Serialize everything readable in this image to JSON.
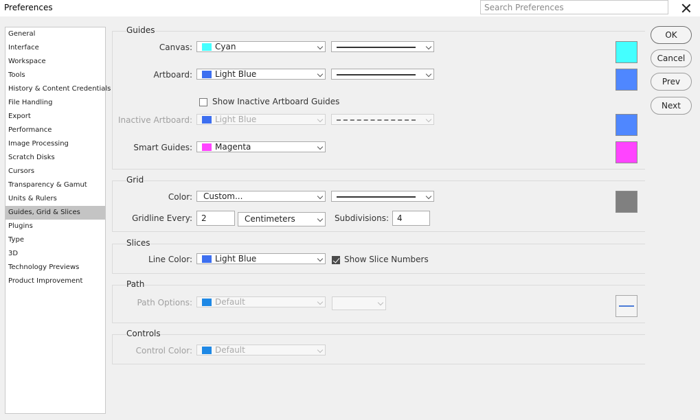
{
  "window": {
    "title": "Preferences"
  },
  "search": {
    "placeholder": "Search Preferences"
  },
  "sidebar": {
    "items": [
      {
        "label": "General"
      },
      {
        "label": "Interface"
      },
      {
        "label": "Workspace"
      },
      {
        "label": "Tools"
      },
      {
        "label": "History & Content Credentials"
      },
      {
        "label": "File Handling"
      },
      {
        "label": "Export"
      },
      {
        "label": "Performance"
      },
      {
        "label": "Image Processing"
      },
      {
        "label": "Scratch Disks"
      },
      {
        "label": "Cursors"
      },
      {
        "label": "Transparency & Gamut"
      },
      {
        "label": "Units & Rulers"
      },
      {
        "label": "Guides, Grid & Slices",
        "selected": true
      },
      {
        "label": "Plugins"
      },
      {
        "label": "Type"
      },
      {
        "label": "3D"
      },
      {
        "label": "Technology Previews"
      },
      {
        "label": "Product Improvement"
      }
    ]
  },
  "guides": {
    "title": "Guides",
    "canvas": {
      "label": "Canvas:",
      "color_name": "Cyan",
      "color": "#44ffff",
      "style": "solid"
    },
    "artboard": {
      "label": "Artboard:",
      "color_name": "Light Blue",
      "color": "#3d6ff0",
      "swatch": "#4f87ff",
      "style": "solid"
    },
    "show_inactive": {
      "label": "Show Inactive Artboard Guides",
      "checked": false
    },
    "inactive_artboard": {
      "label": "Inactive Artboard:",
      "color_name": "Light Blue",
      "color": "#3d6ff0",
      "swatch": "#4f87ff",
      "style": "dashed",
      "disabled": true
    },
    "smart_guides": {
      "label": "Smart Guides:",
      "color_name": "Magenta",
      "color": "#ff44ff"
    }
  },
  "grid": {
    "title": "Grid",
    "color": {
      "label": "Color:",
      "value": "Custom...",
      "style": "solid",
      "swatch": "#808080"
    },
    "gridline_every": {
      "label": "Gridline Every:",
      "value": "2",
      "unit": "Centimeters"
    },
    "subdivisions": {
      "label": "Subdivisions:",
      "value": "4"
    }
  },
  "slices": {
    "title": "Slices",
    "line_color": {
      "label": "Line Color:",
      "color_name": "Light Blue",
      "color": "#3d6ff0"
    },
    "show_numbers": {
      "label": "Show Slice Numbers",
      "checked": true
    }
  },
  "path": {
    "title": "Path",
    "options": {
      "label": "Path Options:",
      "value": "Default",
      "color": "#1e88e5",
      "disabled": true
    }
  },
  "controls": {
    "title": "Controls",
    "color": {
      "label": "Control Color:",
      "value": "Default",
      "color": "#1e88e5",
      "disabled": true
    }
  },
  "buttons": {
    "ok": "OK",
    "cancel": "Cancel",
    "prev": "Prev",
    "next": "Next"
  }
}
